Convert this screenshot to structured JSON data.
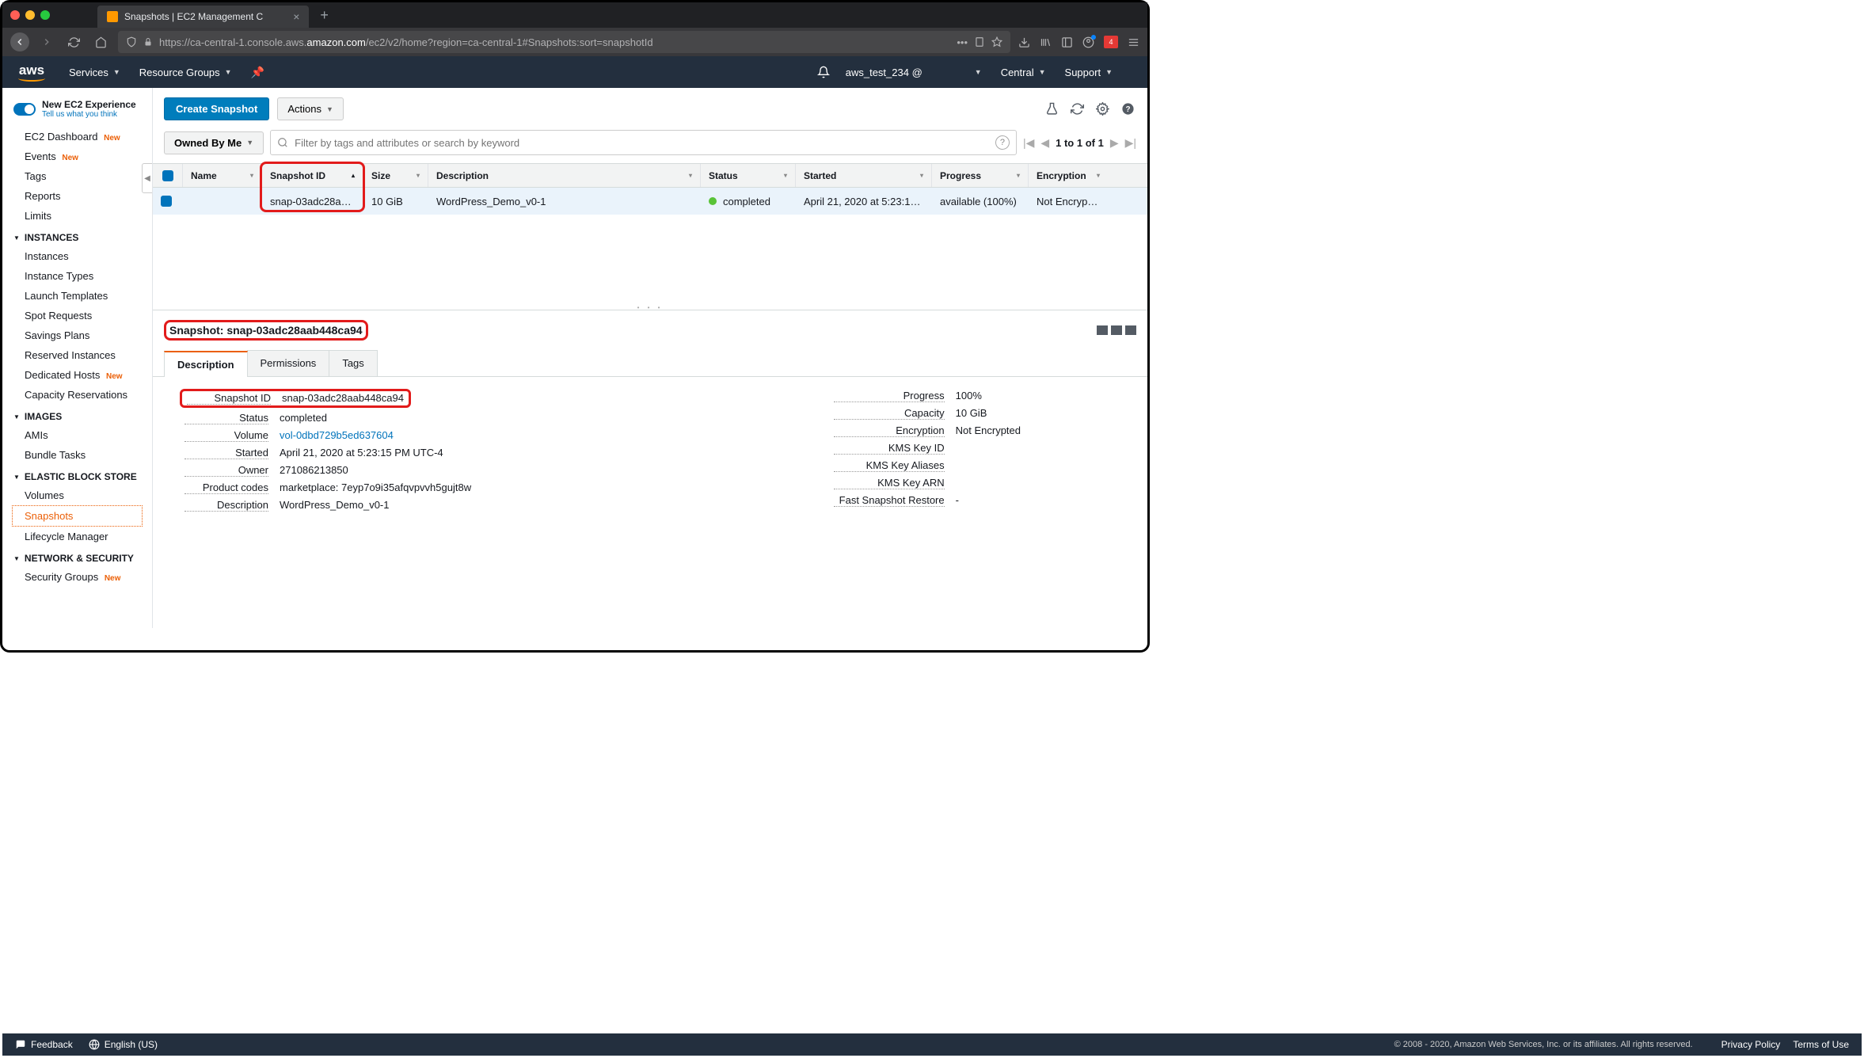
{
  "browser": {
    "tab_title": "Snapshots | EC2 Management C",
    "url_display": "https://ca-central-1.console.aws.amazon.com/ec2/v2/home?region=ca-central-1#Snapshots:sort=snapshotId",
    "url_domain": "amazon.com",
    "url_prefix": "https://ca-central-1.console.aws.",
    "url_suffix": "/ec2/v2/home?region=ca-central-1#Snapshots:sort=snapshotId"
  },
  "awsnav": {
    "logo": "aws",
    "services": "Services",
    "resource_groups": "Resource Groups",
    "user": "aws_test_234 @",
    "region": "Central",
    "support": "Support"
  },
  "sidebar": {
    "new_exp": "New EC2 Experience",
    "tell_us": "Tell us what you think",
    "dashboard": "EC2 Dashboard",
    "events": "Events",
    "tags": "Tags",
    "reports": "Reports",
    "limits": "Limits",
    "sec_instances": "INSTANCES",
    "instances": "Instances",
    "instance_types": "Instance Types",
    "launch_templates": "Launch Templates",
    "spot_requests": "Spot Requests",
    "savings_plans": "Savings Plans",
    "reserved_instances": "Reserved Instances",
    "dedicated_hosts": "Dedicated Hosts",
    "capacity_reservations": "Capacity Reservations",
    "sec_images": "IMAGES",
    "amis": "AMIs",
    "bundle_tasks": "Bundle Tasks",
    "sec_ebs": "ELASTIC BLOCK STORE",
    "volumes": "Volumes",
    "snapshots": "Snapshots",
    "lifecycle_manager": "Lifecycle Manager",
    "sec_network": "NETWORK & SECURITY",
    "security_groups": "Security Groups",
    "new_badge": "New"
  },
  "actions": {
    "create_snapshot": "Create Snapshot",
    "actions": "Actions"
  },
  "filter": {
    "owned_by_me": "Owned By Me",
    "placeholder": "Filter by tags and attributes or search by keyword",
    "pager": "1 to 1 of 1"
  },
  "table": {
    "headers": {
      "name": "Name",
      "snapshot_id": "Snapshot ID",
      "size": "Size",
      "description": "Description",
      "status": "Status",
      "started": "Started",
      "progress": "Progress",
      "encryption": "Encryption"
    },
    "row": {
      "name": "",
      "snapshot_id": "snap-03adc28aab4...",
      "size": "10 GiB",
      "description": "WordPress_Demo_v0-1",
      "status": "completed",
      "started": "April 21, 2020 at 5:23:15 PM...",
      "progress": "available (100%)",
      "encryption": "Not Encrypted"
    }
  },
  "detail": {
    "title": "Snapshot: snap-03adc28aab448ca94",
    "tabs": {
      "description": "Description",
      "permissions": "Permissions",
      "tags": "Tags"
    },
    "left": {
      "snapshot_id_label": "Snapshot ID",
      "snapshot_id": "snap-03adc28aab448ca94",
      "status_label": "Status",
      "status": "completed",
      "volume_label": "Volume",
      "volume": "vol-0dbd729b5ed637604",
      "started_label": "Started",
      "started": "April 21, 2020 at 5:23:15 PM UTC-4",
      "owner_label": "Owner",
      "owner": "271086213850",
      "product_codes_label": "Product codes",
      "product_codes": "marketplace: 7eyp7o9i35afqvpvvh5gujt8w",
      "description_label": "Description",
      "description": "WordPress_Demo_v0-1"
    },
    "right": {
      "progress_label": "Progress",
      "progress": "100%",
      "capacity_label": "Capacity",
      "capacity": "10 GiB",
      "encryption_label": "Encryption",
      "encryption": "Not Encrypted",
      "kms_key_id_label": "KMS Key ID",
      "kms_key_id": "",
      "kms_key_aliases_label": "KMS Key Aliases",
      "kms_key_aliases": "",
      "kms_key_arn_label": "KMS Key ARN",
      "kms_key_arn": "",
      "fast_restore_label": "Fast Snapshot Restore",
      "fast_restore": "-"
    }
  },
  "footer": {
    "feedback": "Feedback",
    "language": "English (US)",
    "copyright": "© 2008 - 2020, Amazon Web Services, Inc. or its affiliates. All rights reserved.",
    "privacy": "Privacy Policy",
    "terms": "Terms of Use"
  }
}
